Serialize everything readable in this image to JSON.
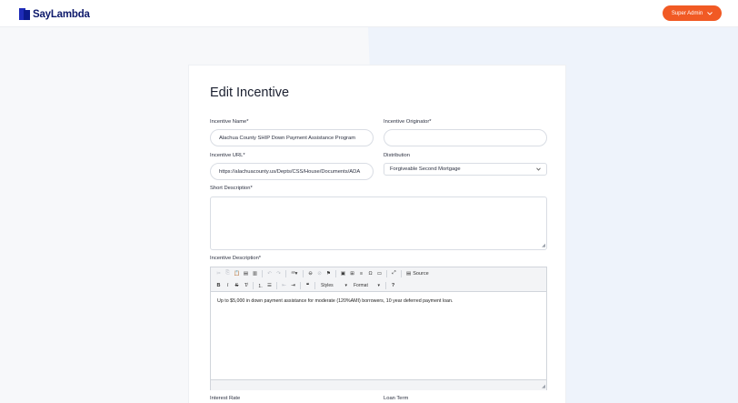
{
  "header": {
    "logo_text": "SayLambda",
    "admin_label": "Super Admin",
    "accent_color": "#f15a24"
  },
  "form": {
    "title": "Edit Incentive",
    "incentive_name_label": "Incentive Name*",
    "incentive_name_value": "Alachua County SHIP Down Payment Assistance Program",
    "originator_label": "Incentive Originator*",
    "originator_value": "",
    "url_label": "Incentive URL*",
    "url_value": "https://alachuacounty.us/Depts/CSS/House/Documents/ADA",
    "distribution_label": "Distribution",
    "distribution_value": "Forgiveable Second Mortgage",
    "short_desc_label": "Short Description*",
    "short_desc_value": "",
    "description_label": "Incentive Description*",
    "description_text": "Up to $5,000 in down payment assistance for moderate (120%AMI) borrowers, 10 year deferred payment loan.",
    "interest_rate_label": "Interest Rate",
    "loan_term_label": "Loan Term"
  },
  "editor": {
    "source_label": "Source",
    "styles_label": "Styles",
    "format_label": "Format",
    "icons": [
      "cut-icon",
      "copy-icon",
      "paste-icon",
      "paste-text-icon",
      "paste-word-icon",
      "undo-icon",
      "redo-icon",
      "spellcheck-icon",
      "link-icon",
      "unlink-icon",
      "anchor-icon",
      "image-icon",
      "table-icon",
      "horizontal-rule-icon",
      "special-char-icon",
      "maximize-icon",
      "source-icon",
      "bold-icon",
      "italic-icon",
      "strike-icon",
      "remove-format-icon",
      "numbered-list-icon",
      "bullet-list-icon",
      "outdent-icon",
      "indent-icon",
      "blockquote-icon",
      "help-icon"
    ]
  }
}
